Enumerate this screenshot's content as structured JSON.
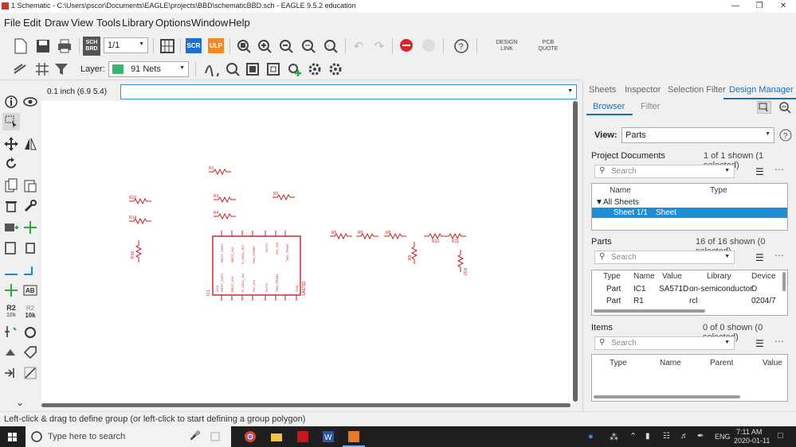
{
  "window": {
    "title": "1 Schematic - C:\\Users\\pscor\\Documents\\EAGLE\\projects\\BBD\\schematicBBD.sch - EAGLE 9.5.2 education"
  },
  "menu": [
    "File",
    "Edit",
    "Draw",
    "View",
    "Tools",
    "Library",
    "Options",
    "Window",
    "Help"
  ],
  "toolbar": {
    "sheet_select": "1/1",
    "scr_label": "SCR",
    "ulp_label": "ULP",
    "brd_label": "SCH BRD",
    "design_link": "DESIGN LINK",
    "pcb_quote": "PCB QUOTE"
  },
  "layerbar": {
    "layer_label": "Layer:",
    "layer_value": "91 Nets",
    "layer_color": "#3cb371"
  },
  "coords": "0.1 inch (6.9 5.4)",
  "command": {
    "value": ""
  },
  "left_tools": {
    "r2_label": "R2",
    "r2_value": "10k"
  },
  "schematic": {
    "ic_name": "IC1",
    "ic_value": "SA571D",
    "parts": [
      "R1",
      "R2",
      "R3",
      "R4",
      "R5",
      "R6",
      "R8",
      "R9",
      "R10",
      "R11",
      "R12",
      "R13",
      "R14",
      "R16"
    ],
    "pins_top": [
      "RECT_CAP2",
      "RECT_IN2",
      "G_CELL_IN2",
      "THD_TRIM2",
      "OUT2",
      "INV_IN2"
    ],
    "pins_bottom": [
      "RECT_CAP1",
      "RECT_IN1",
      "G_CELL_IN1",
      "INV_IN1",
      "OUT1",
      "THD_TRIM1",
      "GND"
    ],
    "pins_right": [
      "VCC"
    ],
    "wire_color": "#c81e1e"
  },
  "status": "Left-click & drag to define group (or left-click to start defining a group polygon)",
  "panel": {
    "tabs": [
      "Sheets",
      "Inspector",
      "Selection Filter",
      "Design Manager"
    ],
    "active_tab": "Design Manager",
    "subtabs": [
      "Browser",
      "Filter"
    ],
    "view_label": "View:",
    "view_value": "Parts",
    "project_docs": {
      "label": "Project Documents",
      "count": "1 of 1 shown (1 selected)",
      "search": "Search",
      "headers": [
        "Name",
        "Type"
      ],
      "root": "All Sheets",
      "rows": [
        {
          "name": "Sheet 1/1",
          "type": "Sheet"
        }
      ]
    },
    "parts": {
      "label": "Parts",
      "count": "16 of 16 shown (0 selected)",
      "search": "Search",
      "headers": [
        "Type",
        "Name",
        "Value",
        "Library",
        "Device"
      ],
      "rows": [
        {
          "type": "Part",
          "name": "IC1",
          "value": "SA571D",
          "library": "on-semiconductor",
          "device": "D"
        },
        {
          "type": "Part",
          "name": "R1",
          "value": "",
          "library": "rcl",
          "device": "0204/7"
        }
      ]
    },
    "items": {
      "label": "Items",
      "count": "0 of 0 shown (0 selected)",
      "search": "Search",
      "headers": [
        "Type",
        "Name",
        "Parent",
        "Value"
      ]
    }
  },
  "taskbar": {
    "search_placeholder": "Type here to search",
    "time": "7:11 AM",
    "date": "2020-01-11",
    "lang": "ENG"
  }
}
